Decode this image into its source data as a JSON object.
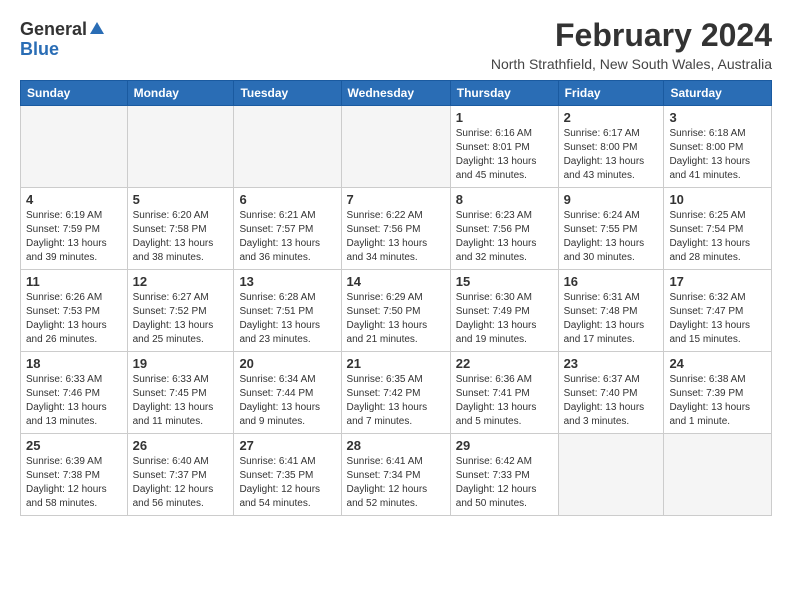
{
  "logo": {
    "general": "General",
    "blue": "Blue"
  },
  "header": {
    "month": "February 2024",
    "location": "North Strathfield, New South Wales, Australia"
  },
  "days_header": [
    "Sunday",
    "Monday",
    "Tuesday",
    "Wednesday",
    "Thursday",
    "Friday",
    "Saturday"
  ],
  "weeks": [
    [
      {
        "day": "",
        "info": ""
      },
      {
        "day": "",
        "info": ""
      },
      {
        "day": "",
        "info": ""
      },
      {
        "day": "",
        "info": ""
      },
      {
        "day": "1",
        "info": "Sunrise: 6:16 AM\nSunset: 8:01 PM\nDaylight: 13 hours\nand 45 minutes."
      },
      {
        "day": "2",
        "info": "Sunrise: 6:17 AM\nSunset: 8:00 PM\nDaylight: 13 hours\nand 43 minutes."
      },
      {
        "day": "3",
        "info": "Sunrise: 6:18 AM\nSunset: 8:00 PM\nDaylight: 13 hours\nand 41 minutes."
      }
    ],
    [
      {
        "day": "4",
        "info": "Sunrise: 6:19 AM\nSunset: 7:59 PM\nDaylight: 13 hours\nand 39 minutes."
      },
      {
        "day": "5",
        "info": "Sunrise: 6:20 AM\nSunset: 7:58 PM\nDaylight: 13 hours\nand 38 minutes."
      },
      {
        "day": "6",
        "info": "Sunrise: 6:21 AM\nSunset: 7:57 PM\nDaylight: 13 hours\nand 36 minutes."
      },
      {
        "day": "7",
        "info": "Sunrise: 6:22 AM\nSunset: 7:56 PM\nDaylight: 13 hours\nand 34 minutes."
      },
      {
        "day": "8",
        "info": "Sunrise: 6:23 AM\nSunset: 7:56 PM\nDaylight: 13 hours\nand 32 minutes."
      },
      {
        "day": "9",
        "info": "Sunrise: 6:24 AM\nSunset: 7:55 PM\nDaylight: 13 hours\nand 30 minutes."
      },
      {
        "day": "10",
        "info": "Sunrise: 6:25 AM\nSunset: 7:54 PM\nDaylight: 13 hours\nand 28 minutes."
      }
    ],
    [
      {
        "day": "11",
        "info": "Sunrise: 6:26 AM\nSunset: 7:53 PM\nDaylight: 13 hours\nand 26 minutes."
      },
      {
        "day": "12",
        "info": "Sunrise: 6:27 AM\nSunset: 7:52 PM\nDaylight: 13 hours\nand 25 minutes."
      },
      {
        "day": "13",
        "info": "Sunrise: 6:28 AM\nSunset: 7:51 PM\nDaylight: 13 hours\nand 23 minutes."
      },
      {
        "day": "14",
        "info": "Sunrise: 6:29 AM\nSunset: 7:50 PM\nDaylight: 13 hours\nand 21 minutes."
      },
      {
        "day": "15",
        "info": "Sunrise: 6:30 AM\nSunset: 7:49 PM\nDaylight: 13 hours\nand 19 minutes."
      },
      {
        "day": "16",
        "info": "Sunrise: 6:31 AM\nSunset: 7:48 PM\nDaylight: 13 hours\nand 17 minutes."
      },
      {
        "day": "17",
        "info": "Sunrise: 6:32 AM\nSunset: 7:47 PM\nDaylight: 13 hours\nand 15 minutes."
      }
    ],
    [
      {
        "day": "18",
        "info": "Sunrise: 6:33 AM\nSunset: 7:46 PM\nDaylight: 13 hours\nand 13 minutes."
      },
      {
        "day": "19",
        "info": "Sunrise: 6:33 AM\nSunset: 7:45 PM\nDaylight: 13 hours\nand 11 minutes."
      },
      {
        "day": "20",
        "info": "Sunrise: 6:34 AM\nSunset: 7:44 PM\nDaylight: 13 hours\nand 9 minutes."
      },
      {
        "day": "21",
        "info": "Sunrise: 6:35 AM\nSunset: 7:42 PM\nDaylight: 13 hours\nand 7 minutes."
      },
      {
        "day": "22",
        "info": "Sunrise: 6:36 AM\nSunset: 7:41 PM\nDaylight: 13 hours\nand 5 minutes."
      },
      {
        "day": "23",
        "info": "Sunrise: 6:37 AM\nSunset: 7:40 PM\nDaylight: 13 hours\nand 3 minutes."
      },
      {
        "day": "24",
        "info": "Sunrise: 6:38 AM\nSunset: 7:39 PM\nDaylight: 13 hours\nand 1 minute."
      }
    ],
    [
      {
        "day": "25",
        "info": "Sunrise: 6:39 AM\nSunset: 7:38 PM\nDaylight: 12 hours\nand 58 minutes."
      },
      {
        "day": "26",
        "info": "Sunrise: 6:40 AM\nSunset: 7:37 PM\nDaylight: 12 hours\nand 56 minutes."
      },
      {
        "day": "27",
        "info": "Sunrise: 6:41 AM\nSunset: 7:35 PM\nDaylight: 12 hours\nand 54 minutes."
      },
      {
        "day": "28",
        "info": "Sunrise: 6:41 AM\nSunset: 7:34 PM\nDaylight: 12 hours\nand 52 minutes."
      },
      {
        "day": "29",
        "info": "Sunrise: 6:42 AM\nSunset: 7:33 PM\nDaylight: 12 hours\nand 50 minutes."
      },
      {
        "day": "",
        "info": ""
      },
      {
        "day": "",
        "info": ""
      }
    ]
  ]
}
